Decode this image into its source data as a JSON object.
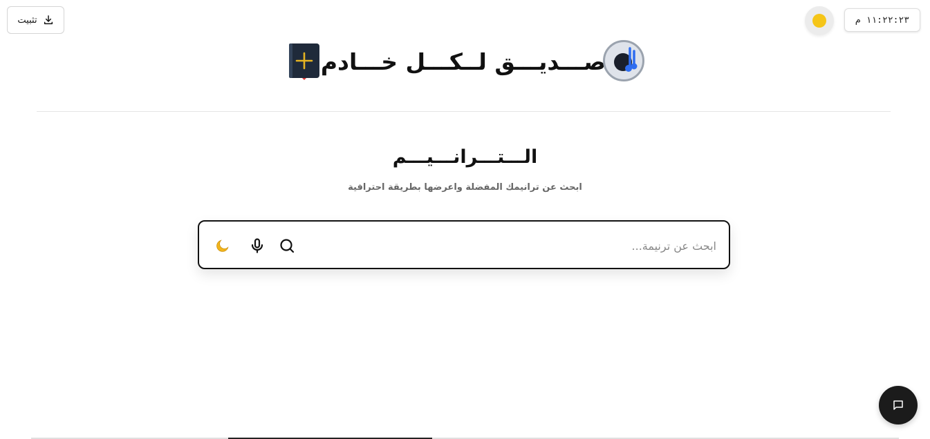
{
  "topbar": {
    "install_label": "تثبيت",
    "clock_text": "١١:٢٢:٢٣ م"
  },
  "header": {
    "site_title": "صـــديـــق لــكـــل خـــادم"
  },
  "hero": {
    "title": "الـــتـــرانـــيـــم",
    "subtitle": "ابحث عن ترانيمك المفضلة واعرضها بطريقة احترافية"
  },
  "search": {
    "placeholder": "ابحث عن ترنيمة...",
    "value": ""
  },
  "icons": {
    "install": "download-icon",
    "theme_light": "sun-icon",
    "bible": "bible-icon",
    "logo": "music-note-icon",
    "search": "search-icon",
    "mic": "microphone-icon",
    "moon": "moon-icon",
    "chat": "chat-icon"
  },
  "colors": {
    "sun": "#f5c518",
    "book": "#1f2a3a",
    "book_plus": "#e6b422",
    "logo_note": "#2f6df0",
    "chat_fab": "#1b1b1b"
  }
}
